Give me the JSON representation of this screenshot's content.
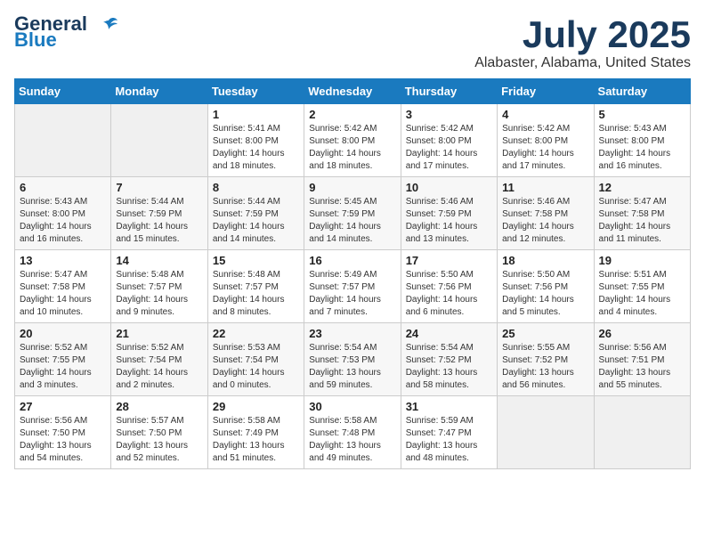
{
  "header": {
    "logo_line1": "General",
    "logo_line2": "Blue",
    "month_year": "July 2025",
    "location": "Alabaster, Alabama, United States"
  },
  "weekdays": [
    "Sunday",
    "Monday",
    "Tuesday",
    "Wednesday",
    "Thursday",
    "Friday",
    "Saturday"
  ],
  "weeks": [
    [
      {
        "day": "",
        "info": ""
      },
      {
        "day": "",
        "info": ""
      },
      {
        "day": "1",
        "info": "Sunrise: 5:41 AM\nSunset: 8:00 PM\nDaylight: 14 hours\nand 18 minutes."
      },
      {
        "day": "2",
        "info": "Sunrise: 5:42 AM\nSunset: 8:00 PM\nDaylight: 14 hours\nand 18 minutes."
      },
      {
        "day": "3",
        "info": "Sunrise: 5:42 AM\nSunset: 8:00 PM\nDaylight: 14 hours\nand 17 minutes."
      },
      {
        "day": "4",
        "info": "Sunrise: 5:42 AM\nSunset: 8:00 PM\nDaylight: 14 hours\nand 17 minutes."
      },
      {
        "day": "5",
        "info": "Sunrise: 5:43 AM\nSunset: 8:00 PM\nDaylight: 14 hours\nand 16 minutes."
      }
    ],
    [
      {
        "day": "6",
        "info": "Sunrise: 5:43 AM\nSunset: 8:00 PM\nDaylight: 14 hours\nand 16 minutes."
      },
      {
        "day": "7",
        "info": "Sunrise: 5:44 AM\nSunset: 7:59 PM\nDaylight: 14 hours\nand 15 minutes."
      },
      {
        "day": "8",
        "info": "Sunrise: 5:44 AM\nSunset: 7:59 PM\nDaylight: 14 hours\nand 14 minutes."
      },
      {
        "day": "9",
        "info": "Sunrise: 5:45 AM\nSunset: 7:59 PM\nDaylight: 14 hours\nand 14 minutes."
      },
      {
        "day": "10",
        "info": "Sunrise: 5:46 AM\nSunset: 7:59 PM\nDaylight: 14 hours\nand 13 minutes."
      },
      {
        "day": "11",
        "info": "Sunrise: 5:46 AM\nSunset: 7:58 PM\nDaylight: 14 hours\nand 12 minutes."
      },
      {
        "day": "12",
        "info": "Sunrise: 5:47 AM\nSunset: 7:58 PM\nDaylight: 14 hours\nand 11 minutes."
      }
    ],
    [
      {
        "day": "13",
        "info": "Sunrise: 5:47 AM\nSunset: 7:58 PM\nDaylight: 14 hours\nand 10 minutes."
      },
      {
        "day": "14",
        "info": "Sunrise: 5:48 AM\nSunset: 7:57 PM\nDaylight: 14 hours\nand 9 minutes."
      },
      {
        "day": "15",
        "info": "Sunrise: 5:48 AM\nSunset: 7:57 PM\nDaylight: 14 hours\nand 8 minutes."
      },
      {
        "day": "16",
        "info": "Sunrise: 5:49 AM\nSunset: 7:57 PM\nDaylight: 14 hours\nand 7 minutes."
      },
      {
        "day": "17",
        "info": "Sunrise: 5:50 AM\nSunset: 7:56 PM\nDaylight: 14 hours\nand 6 minutes."
      },
      {
        "day": "18",
        "info": "Sunrise: 5:50 AM\nSunset: 7:56 PM\nDaylight: 14 hours\nand 5 minutes."
      },
      {
        "day": "19",
        "info": "Sunrise: 5:51 AM\nSunset: 7:55 PM\nDaylight: 14 hours\nand 4 minutes."
      }
    ],
    [
      {
        "day": "20",
        "info": "Sunrise: 5:52 AM\nSunset: 7:55 PM\nDaylight: 14 hours\nand 3 minutes."
      },
      {
        "day": "21",
        "info": "Sunrise: 5:52 AM\nSunset: 7:54 PM\nDaylight: 14 hours\nand 2 minutes."
      },
      {
        "day": "22",
        "info": "Sunrise: 5:53 AM\nSunset: 7:54 PM\nDaylight: 14 hours\nand 0 minutes."
      },
      {
        "day": "23",
        "info": "Sunrise: 5:54 AM\nSunset: 7:53 PM\nDaylight: 13 hours\nand 59 minutes."
      },
      {
        "day": "24",
        "info": "Sunrise: 5:54 AM\nSunset: 7:52 PM\nDaylight: 13 hours\nand 58 minutes."
      },
      {
        "day": "25",
        "info": "Sunrise: 5:55 AM\nSunset: 7:52 PM\nDaylight: 13 hours\nand 56 minutes."
      },
      {
        "day": "26",
        "info": "Sunrise: 5:56 AM\nSunset: 7:51 PM\nDaylight: 13 hours\nand 55 minutes."
      }
    ],
    [
      {
        "day": "27",
        "info": "Sunrise: 5:56 AM\nSunset: 7:50 PM\nDaylight: 13 hours\nand 54 minutes."
      },
      {
        "day": "28",
        "info": "Sunrise: 5:57 AM\nSunset: 7:50 PM\nDaylight: 13 hours\nand 52 minutes."
      },
      {
        "day": "29",
        "info": "Sunrise: 5:58 AM\nSunset: 7:49 PM\nDaylight: 13 hours\nand 51 minutes."
      },
      {
        "day": "30",
        "info": "Sunrise: 5:58 AM\nSunset: 7:48 PM\nDaylight: 13 hours\nand 49 minutes."
      },
      {
        "day": "31",
        "info": "Sunrise: 5:59 AM\nSunset: 7:47 PM\nDaylight: 13 hours\nand 48 minutes."
      },
      {
        "day": "",
        "info": ""
      },
      {
        "day": "",
        "info": ""
      }
    ]
  ]
}
